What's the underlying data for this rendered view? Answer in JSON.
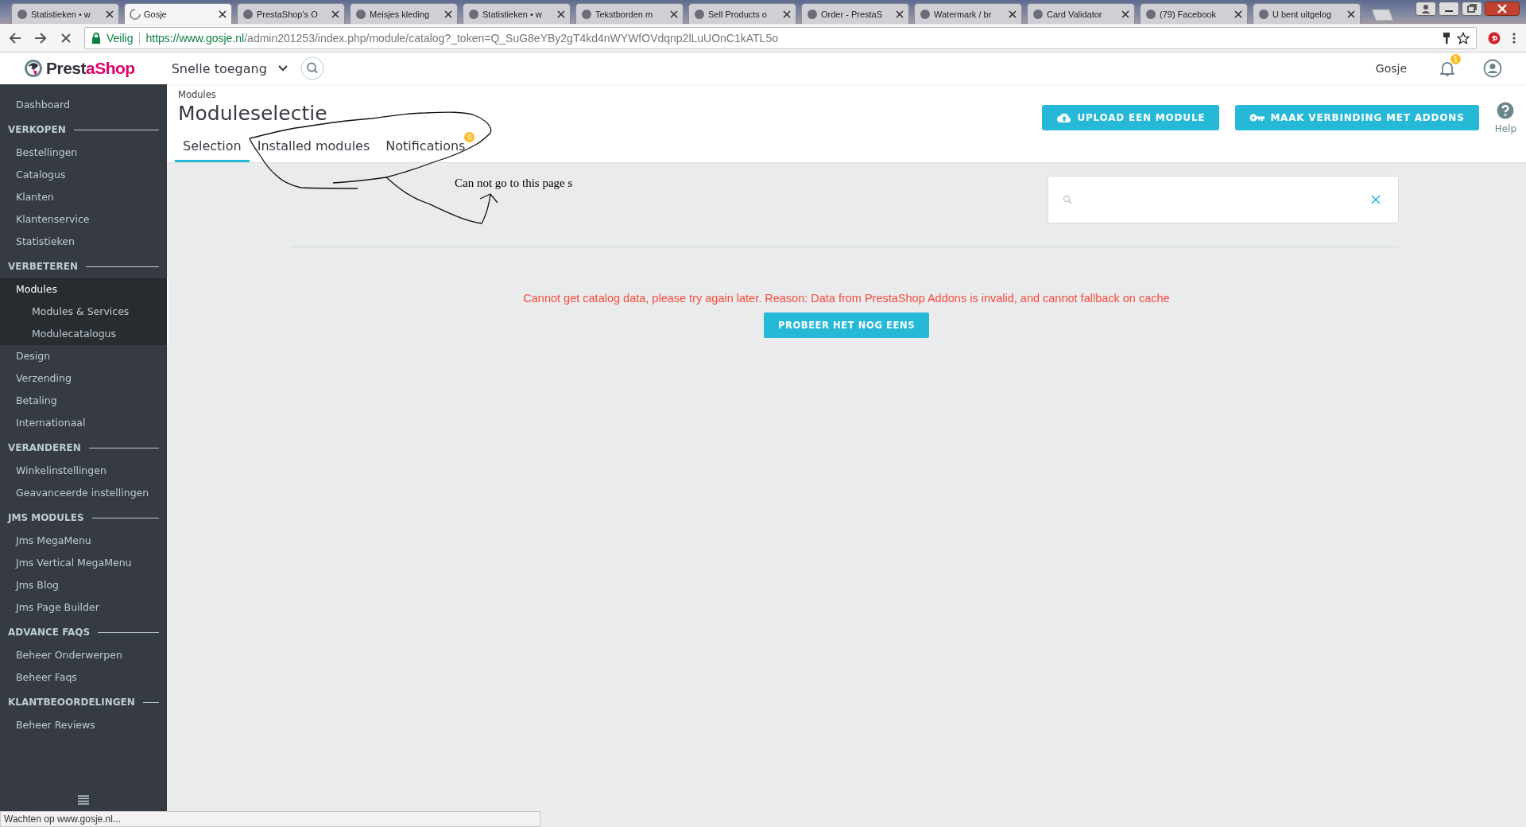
{
  "browser": {
    "tabs": [
      {
        "label": "Statistieken • w",
        "selected": false
      },
      {
        "label": "Gosje",
        "selected": true
      },
      {
        "label": "PrestaShop's O",
        "selected": false
      },
      {
        "label": "Meisjes kleding",
        "selected": false
      },
      {
        "label": "Statistieken • w",
        "selected": false
      },
      {
        "label": "Tekstborden m",
        "selected": false
      },
      {
        "label": "Sell Products o",
        "selected": false
      },
      {
        "label": "Order - PrestaS",
        "selected": false
      },
      {
        "label": "Watermark / br",
        "selected": false
      },
      {
        "label": "Card Validator",
        "selected": false
      },
      {
        "label": "(79) Facebook",
        "selected": false
      },
      {
        "label": "U bent uitgelog",
        "selected": false
      }
    ],
    "secure_label": "Veilig",
    "url_host": "https://www.gosje.nl",
    "url_path": "/admin201253/index.php/module/catalog?_token=Q_SuG8eYBy2gT4kd4nWYWfOVdqnp2lLuUOnC1kATL5o",
    "status_text": "Wachten op www.gosje.nl..."
  },
  "header": {
    "logo": "PrestaShop",
    "quick_access": "Snelle toegang",
    "shop_name": "Gosje",
    "notification_count": "1"
  },
  "sidebar": {
    "items": [
      {
        "kind": "link",
        "label": "Dashboard",
        "selected": false
      },
      {
        "kind": "section",
        "label": "VERKOPEN"
      },
      {
        "kind": "link",
        "label": "Bestellingen",
        "selected": false
      },
      {
        "kind": "link",
        "label": "Catalogus",
        "selected": false
      },
      {
        "kind": "link",
        "label": "Klanten",
        "selected": false
      },
      {
        "kind": "link",
        "label": "Klantenservice",
        "selected": false
      },
      {
        "kind": "link",
        "label": "Statistieken",
        "selected": false
      },
      {
        "kind": "section",
        "label": "VERBETEREN"
      },
      {
        "kind": "link",
        "label": "Modules",
        "selected": true,
        "children": [
          {
            "label": "Modules & Services"
          },
          {
            "label": "Modulecatalogus"
          }
        ]
      },
      {
        "kind": "link",
        "label": "Design",
        "selected": false
      },
      {
        "kind": "link",
        "label": "Verzending",
        "selected": false
      },
      {
        "kind": "link",
        "label": "Betaling",
        "selected": false
      },
      {
        "kind": "link",
        "label": "Internationaal",
        "selected": false
      },
      {
        "kind": "section",
        "label": "VERANDEREN"
      },
      {
        "kind": "link",
        "label": "Winkelinstellingen",
        "selected": false
      },
      {
        "kind": "link",
        "label": "Geavanceerde instellingen",
        "selected": false
      },
      {
        "kind": "section",
        "label": "JMS MODULES"
      },
      {
        "kind": "link",
        "label": "Jms MegaMenu",
        "selected": false
      },
      {
        "kind": "link",
        "label": "Jms Vertical MegaMenu",
        "selected": false
      },
      {
        "kind": "link",
        "label": "Jms Blog",
        "selected": false
      },
      {
        "kind": "link",
        "label": "Jms Page Builder",
        "selected": false
      },
      {
        "kind": "section",
        "label": "ADVANCE FAQS"
      },
      {
        "kind": "link",
        "label": "Beheer Onderwerpen",
        "selected": false
      },
      {
        "kind": "link",
        "label": "Beheer Faqs",
        "selected": false
      },
      {
        "kind": "section",
        "label": "KLANTBEOORDELINGEN"
      },
      {
        "kind": "link",
        "label": "Beheer Reviews",
        "selected": false
      }
    ]
  },
  "page": {
    "breadcrumb": "Modules",
    "title": "Moduleselectie",
    "tabs": [
      {
        "label": "Selection",
        "selected": true
      },
      {
        "label": "Installed modules",
        "selected": false
      },
      {
        "label": "Notifications",
        "selected": false,
        "badge": "0"
      }
    ],
    "buttons": [
      {
        "kind": "upload",
        "label": "UPLOAD EEN MODULE"
      },
      {
        "kind": "connect",
        "label": "MAAK VERBINDING MET ADDONS"
      }
    ],
    "help": "Help",
    "error": "Cannot get catalog data, please try again later. Reason: Data from PrestaShop Addons is invalid, and cannot fallback on cache",
    "retry": "PROBEER HET NOG EENS",
    "annotation": "Can not go to this page s"
  }
}
